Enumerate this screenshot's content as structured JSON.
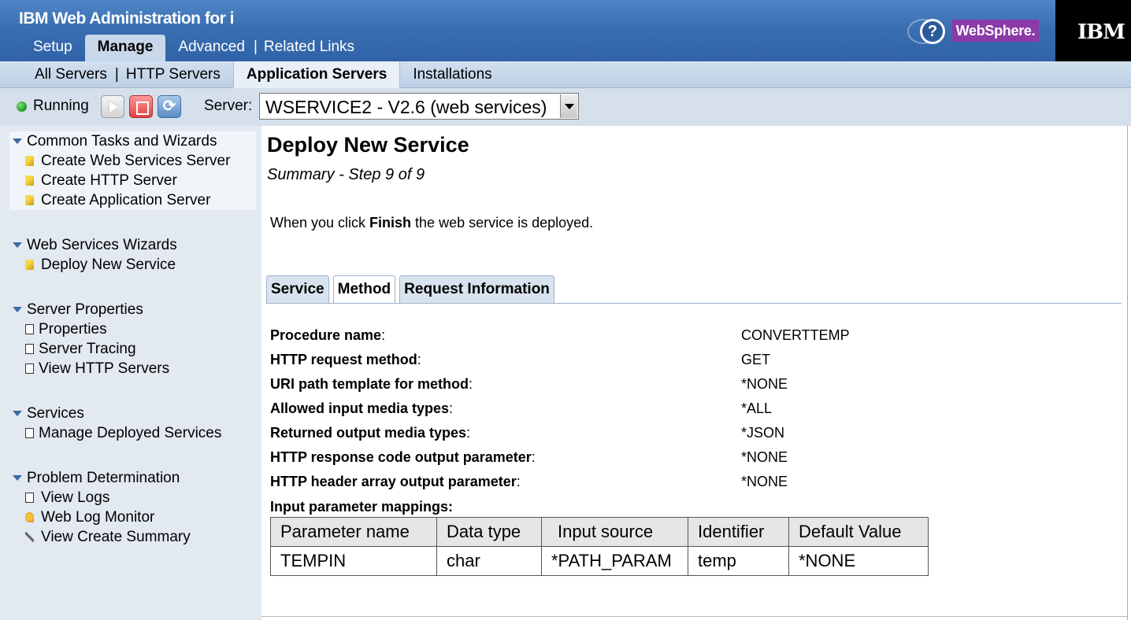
{
  "header": {
    "app_title": "IBM Web Administration for i",
    "main_tabs": [
      "Setup",
      "Manage",
      "Advanced",
      "Related Links"
    ],
    "websphere_label": "WebSphere.",
    "ibm_label": "IBM",
    "help_label": "?"
  },
  "subnav": {
    "items": [
      "All Servers",
      "HTTP Servers",
      "Application Servers",
      "Installations"
    ]
  },
  "toolbar": {
    "status": "Running",
    "server_label": "Server:",
    "server_value": "WSERVICE2 - V2.6 (web services)"
  },
  "sidebar": {
    "groups": [
      {
        "title": "Common Tasks and Wizards",
        "items": [
          "Create Web Services Server",
          "Create HTTP Server",
          "Create Application Server"
        ]
      },
      {
        "title": "Web Services Wizards",
        "items": [
          "Deploy New Service"
        ]
      },
      {
        "title": "Server Properties",
        "items": [
          "Properties",
          "Server Tracing",
          "View HTTP Servers"
        ]
      },
      {
        "title": "Services",
        "items": [
          "Manage Deployed Services"
        ]
      },
      {
        "title": "Problem Determination",
        "items": [
          "View Logs",
          "Web Log Monitor",
          "View Create Summary"
        ]
      }
    ]
  },
  "content": {
    "title": "Deploy New Service",
    "subtitle": "Summary - Step 9 of 9",
    "intro_before": "When you click ",
    "intro_bold": "Finish",
    "intro_after": " the web service is deployed.",
    "tabs": [
      "Service",
      "Method",
      "Request Information"
    ],
    "properties": [
      {
        "label": "Procedure name",
        "value": "CONVERTTEMP"
      },
      {
        "label": "HTTP request method",
        "value": "GET"
      },
      {
        "label": "URI path template for method",
        "value": "*NONE"
      },
      {
        "label": "Allowed input media types",
        "value": "*ALL"
      },
      {
        "label": "Returned output media types",
        "value": "*JSON"
      },
      {
        "label": "HTTP response code output parameter",
        "value": "*NONE"
      },
      {
        "label": "HTTP header array output parameter",
        "value": "*NONE"
      }
    ],
    "mappings_label": "Input parameter mappings:",
    "mappings_table": {
      "headers": [
        "Parameter name",
        "Data type",
        "Input source",
        "Identifier",
        "Default Value"
      ],
      "rows": [
        [
          "TEMPIN",
          "char",
          "*PATH_PARAM",
          "temp",
          "*NONE"
        ]
      ]
    }
  }
}
